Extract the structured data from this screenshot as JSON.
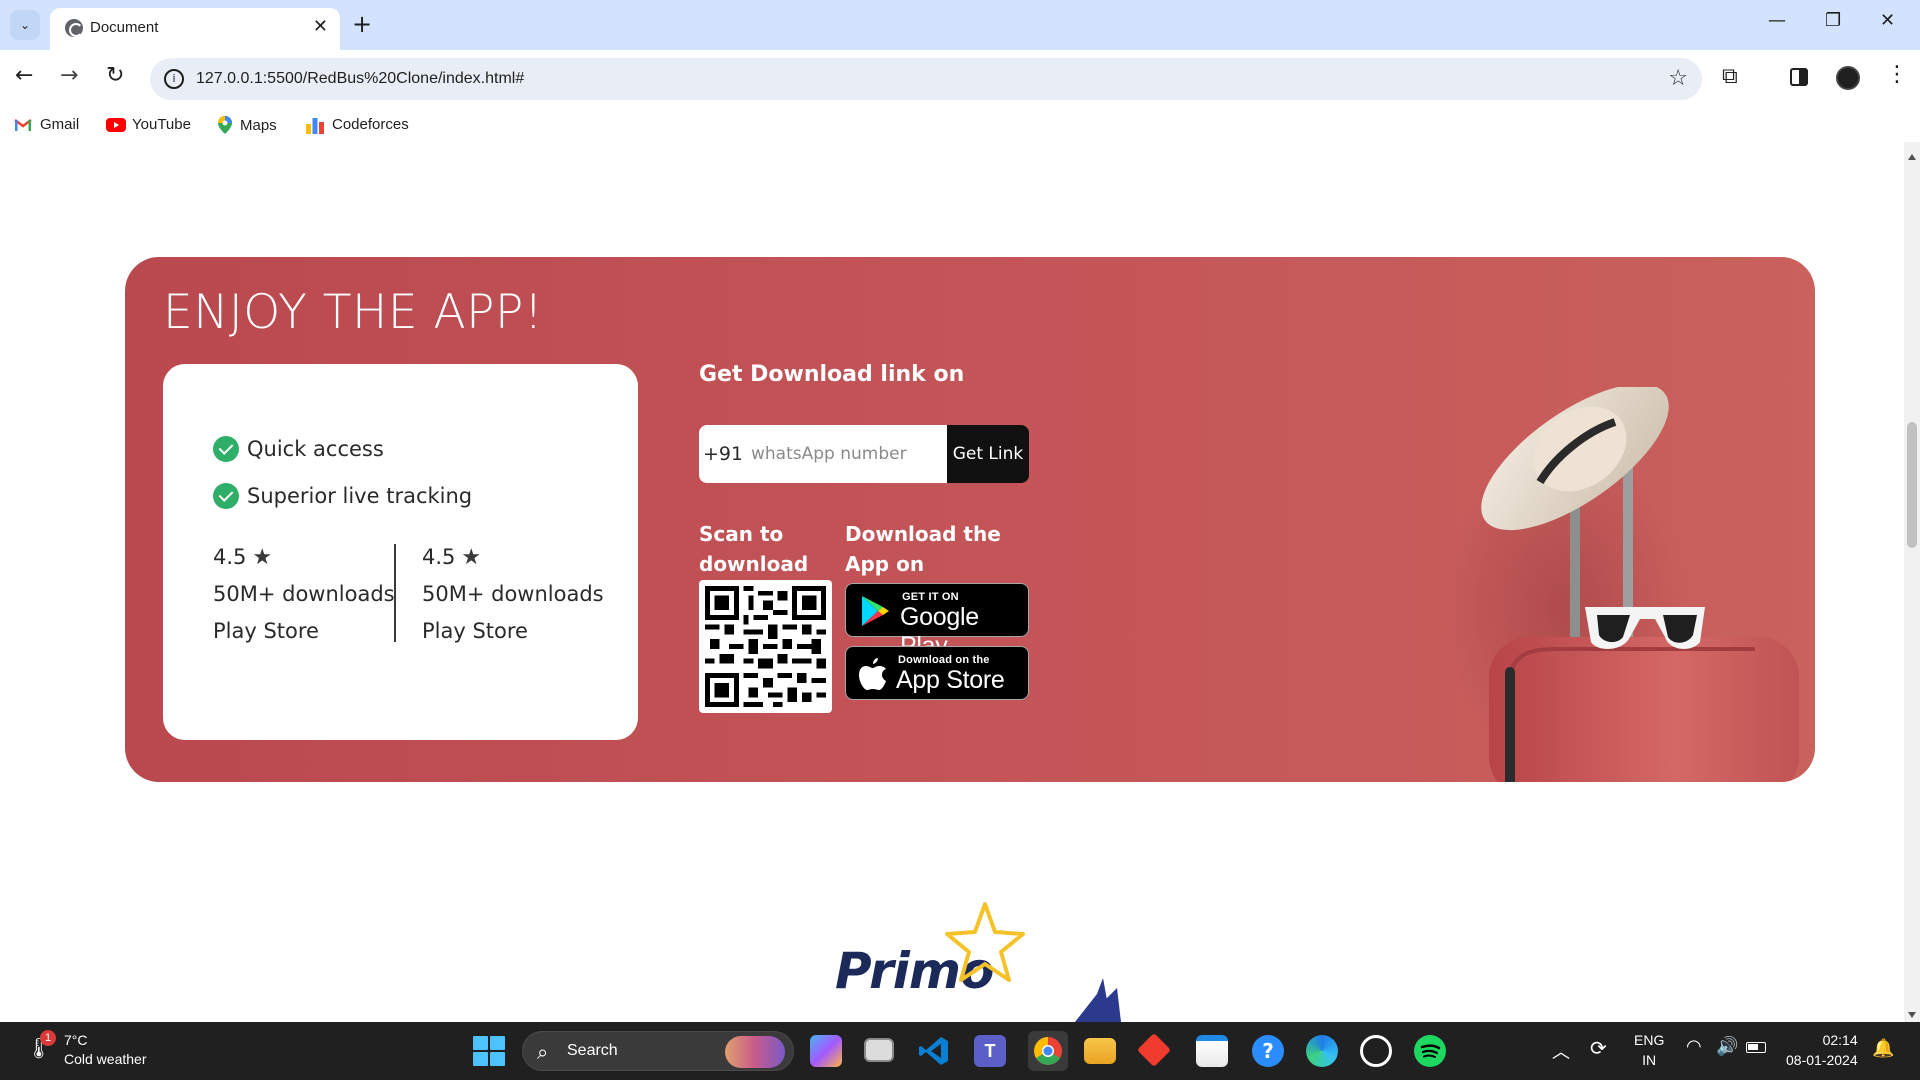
{
  "browser": {
    "tab_title": "Document",
    "tab_close": "✕",
    "new_tab": "+",
    "url": "127.0.0.1:5500/RedBus%20Clone/index.html#",
    "window_controls": {
      "minimize": "—",
      "maximize": "❐",
      "close": "✕"
    },
    "nav": {
      "back": "←",
      "forward": "→",
      "reload": "↻"
    },
    "bookmarks": [
      {
        "label": "Gmail",
        "icon": "gmail-icon"
      },
      {
        "label": "YouTube",
        "icon": "youtube-icon"
      },
      {
        "label": "Maps",
        "icon": "maps-icon"
      },
      {
        "label": "Codeforces",
        "icon": "codeforces-icon"
      }
    ]
  },
  "banner": {
    "title": "ENJOY THE APP!",
    "background_color": "#c45558",
    "features": [
      "Quick access",
      "Superior live tracking"
    ],
    "ratings": [
      {
        "score": "4.5",
        "downloads": "50M+ downloads",
        "store": "Play Store"
      },
      {
        "score": "4.5",
        "downloads": "50M+ downloads",
        "store": "Play Store"
      }
    ],
    "download_heading": "Get Download link on",
    "country_code": "+91",
    "phone_placeholder": "whatsApp number",
    "get_link_label": "Get Link",
    "scan_label": "Scan to download",
    "download_app_label": "Download the App on",
    "google_play": {
      "small": "GET IT ON",
      "big": "Google Play"
    },
    "app_store": {
      "small": "Download on the",
      "big": "App Store"
    }
  },
  "footer_logo": {
    "text": "Primo"
  },
  "taskbar": {
    "weather": {
      "badge": "1",
      "temp": "7°C",
      "desc": "Cold weather"
    },
    "search_label": "Search",
    "language": {
      "line1": "ENG",
      "line2": "IN"
    },
    "clock": {
      "time": "02:14",
      "date": "08-01-2024"
    },
    "apps": [
      "copilot-icon",
      "task-view-icon",
      "vscode-icon",
      "teams-icon",
      "chrome-icon",
      "file-explorer-icon",
      "anydesk-icon",
      "ms-store-icon",
      "help-icon",
      "edge-icon",
      "whatsapp-icon",
      "spotify-icon"
    ]
  }
}
